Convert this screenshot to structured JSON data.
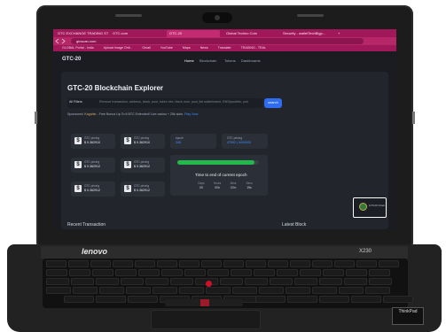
{
  "browser": {
    "tabs": [
      "GTC EXCHANGE TRADING ST",
      "GTC.com",
      "GTC-20",
      "Global Techno Coin",
      "Security - walletTechBlgp..."
    ],
    "new_tab": "+",
    "url": "gtcscan.com",
    "bookmarks": [
      "GLOBAL Portal - India",
      "Upload Image Onli...",
      "Gmail",
      "YouTube",
      "Maps",
      "News",
      "Translate",
      "TRADING - TRAL"
    ]
  },
  "site": {
    "logo": "GTC-20",
    "nav": [
      "Home",
      "Blockchain",
      "Tokens",
      "Dashboards"
    ],
    "title": "GTC-20 Blockchain Explorer",
    "filter_label": "All Filters",
    "search_placeholder": "Remove transaction, address, block, pool, token hex, block num, pool_list wallet/name, ENS/pool/etc, pub",
    "search_button": "search",
    "sponsored_label": "Sponsored:",
    "sponsored_brand": "Koyphin",
    "sponsored_text": "- Free Bonus Up To 6 BTC Extended! Live casino + 25k slots.",
    "sponsored_cta": "Play Now",
    "price_cards": [
      {
        "label": "GTC pricing",
        "value": "$ 0.362910"
      },
      {
        "label": "GTC pricing",
        "value": "$ 0.362910"
      },
      {
        "label": "GTC pricing",
        "value": "$ 0.362912"
      },
      {
        "label": "GTC pricing",
        "value": "$ 0.362912"
      },
      {
        "label": "GTC pricing",
        "value": "$ 0.362912"
      },
      {
        "label": "GTC pricing",
        "value": "$ 0.362912"
      }
    ],
    "info_cards": [
      {
        "label": "epoch",
        "value": "346"
      },
      {
        "label": "GTC pricing",
        "value": "47592 | 9400000"
      }
    ],
    "progress_fraction": 0.95,
    "timer_title": "Time to end of current epoch",
    "timer_units": [
      "Days",
      "Hours",
      "Mins",
      "Secs"
    ],
    "timer_values": [
      "00",
      "00h",
      "47m",
      "19s"
    ],
    "section_left": "Recent Transaction",
    "section_right": "Latest Block",
    "popup_text": "GTC20 Chain"
  },
  "laptop": {
    "brand": "lenovo",
    "model": "X230",
    "sticker": "ThinkPad"
  }
}
